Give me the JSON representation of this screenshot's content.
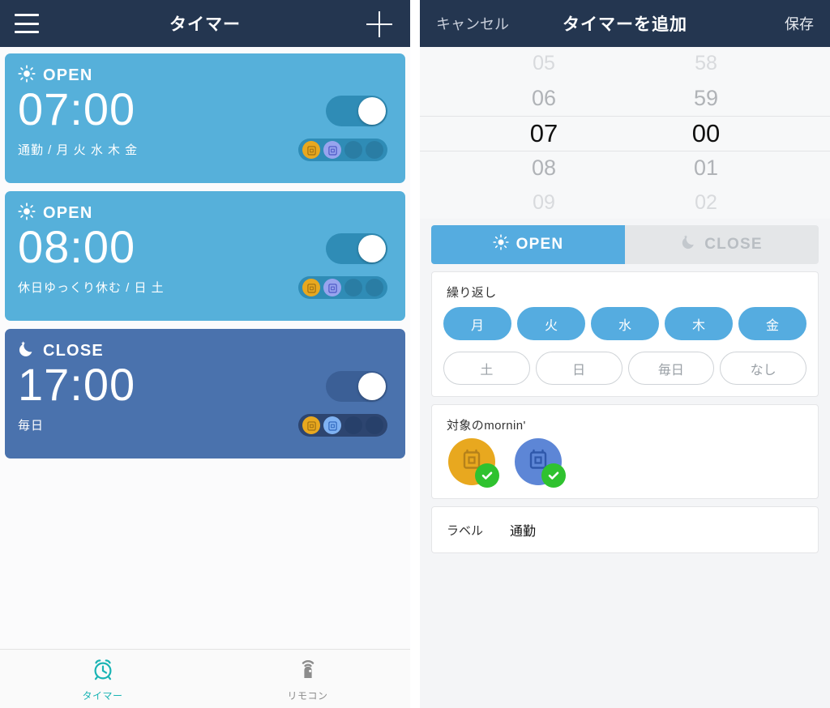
{
  "left": {
    "header": {
      "title": "タイマー",
      "menu_icon": "hamburger-icon",
      "add_icon": "plus-icon"
    },
    "timers": [
      {
        "mode": "OPEN",
        "mode_icon": "sun-icon",
        "time": "07:00",
        "subtitle": "通勤 / 月 火 水 木 金",
        "enabled": true,
        "theme": "open",
        "devices": [
          "yellow",
          "purple",
          "empty",
          "empty"
        ]
      },
      {
        "mode": "OPEN",
        "mode_icon": "sun-icon",
        "time": "08:00",
        "subtitle": "休日ゆっくり休む / 日 土",
        "enabled": true,
        "theme": "open",
        "devices": [
          "yellow",
          "purple",
          "empty",
          "empty"
        ]
      },
      {
        "mode": "CLOSE",
        "mode_icon": "moon-icon",
        "time": "17:00",
        "subtitle": "毎日",
        "enabled": true,
        "theme": "close",
        "devices": [
          "yellow",
          "blue",
          "empty",
          "empty"
        ]
      }
    ],
    "tabbar": [
      {
        "label": "タイマー",
        "icon": "alarm-clock-icon",
        "active": true
      },
      {
        "label": "リモコン",
        "icon": "remote-icon",
        "active": false
      }
    ]
  },
  "right": {
    "header": {
      "cancel": "キャンセル",
      "title": "タイマーを追加",
      "save": "保存"
    },
    "picker": {
      "hours": [
        "05",
        "06",
        "07",
        "08",
        "09"
      ],
      "minutes": [
        "58",
        "59",
        "00",
        "01",
        "02"
      ],
      "selected_hour": "07",
      "selected_minute": "00"
    },
    "mode_segment": {
      "open_label": "OPEN",
      "close_label": "CLOSE",
      "selected": "OPEN"
    },
    "repeat": {
      "title": "繰り返し",
      "row1": [
        {
          "label": "月",
          "selected": true
        },
        {
          "label": "火",
          "selected": true
        },
        {
          "label": "水",
          "selected": true
        },
        {
          "label": "木",
          "selected": true
        },
        {
          "label": "金",
          "selected": true
        }
      ],
      "row2": [
        {
          "label": "土",
          "selected": false
        },
        {
          "label": "日",
          "selected": false
        },
        {
          "label": "毎日",
          "selected": false
        },
        {
          "label": "なし",
          "selected": false
        }
      ]
    },
    "devices": {
      "title": "対象のmornin'",
      "items": [
        {
          "color": "#e8a81f",
          "glyph_color": "#b5811a",
          "checked": true
        },
        {
          "color": "#5d86d6",
          "glyph_color": "#2f58ab",
          "checked": true
        }
      ]
    },
    "label": {
      "key": "ラベル",
      "value": "通勤"
    }
  },
  "colors": {
    "navbar": "#243650",
    "open_card": "#56b0da",
    "close_card": "#4a72ad",
    "accent": "#55ace0",
    "tab_active": "#19b4b4",
    "check_green": "#2fc22f",
    "device_yellow": "#e8a81f",
    "device_purple": "#8f9ceb",
    "device_blue": "#6fa8ef"
  }
}
